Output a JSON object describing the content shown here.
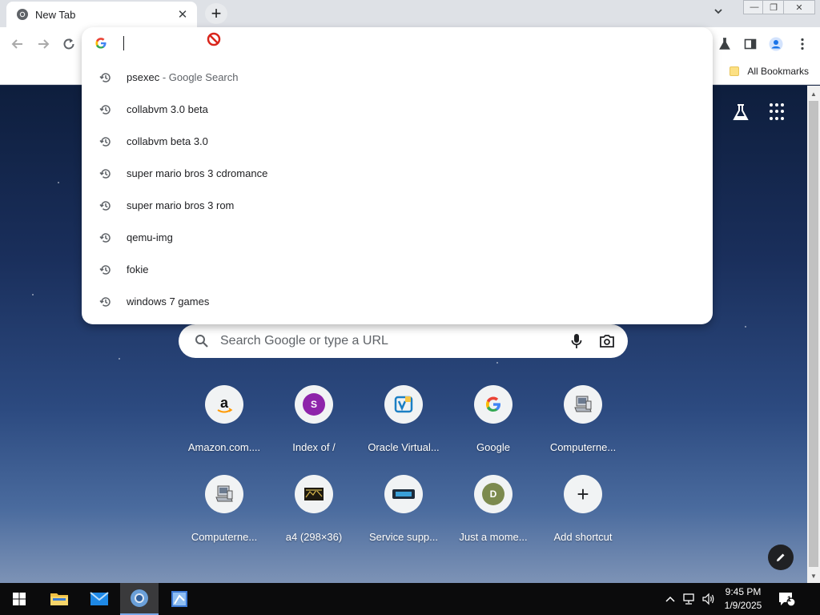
{
  "tab": {
    "title": "New Tab",
    "close_glyph": "✕"
  },
  "newtab_glyph": "+",
  "window_controls": {
    "minimize": "—",
    "maximize": "❐",
    "close": "✕"
  },
  "bookmarks": {
    "all_label": "All Bookmarks"
  },
  "omnibox": {
    "value": "",
    "suggestions": [
      {
        "text": "psexec",
        "suffix": " - Google Search"
      },
      {
        "text": "collabvm 3.0 beta",
        "suffix": ""
      },
      {
        "text": "collabvm beta 3.0",
        "suffix": ""
      },
      {
        "text": "super mario bros 3 cdromance",
        "suffix": ""
      },
      {
        "text": "super mario bros 3 rom",
        "suffix": ""
      },
      {
        "text": "qemu-img",
        "suffix": ""
      },
      {
        "text": "fokie",
        "suffix": ""
      },
      {
        "text": "windows 7 games",
        "suffix": ""
      }
    ]
  },
  "ntp": {
    "search_placeholder": "Search Google or type a URL",
    "shortcuts": [
      {
        "label": "Amazon.com....",
        "icon": "amazon-icon"
      },
      {
        "label": "Index of /",
        "icon": "letter-s-icon",
        "letter": "S"
      },
      {
        "label": "Oracle Virtual...",
        "icon": "virtualbox-icon"
      },
      {
        "label": "Google",
        "icon": "google-icon"
      },
      {
        "label": "Computerne...",
        "icon": "computer-icon"
      },
      {
        "label": "Computerne...",
        "icon": "computer-icon"
      },
      {
        "label": "a4 (298×36)",
        "icon": "image-thumbnail-icon"
      },
      {
        "label": "Service supp...",
        "icon": "service-logo-icon"
      },
      {
        "label": "Just a mome...",
        "icon": "letter-d-icon",
        "letter": "D"
      },
      {
        "label": "Add shortcut",
        "icon": "plus-icon",
        "glyph": "+"
      }
    ]
  },
  "taskbar": {
    "time": "9:45 PM",
    "date": "1/9/2025",
    "notification_count": "1"
  },
  "colors": {
    "accent_blue": "#1a73e8",
    "shortcut_s_bg": "#8e24aa",
    "shortcut_d_bg": "#7c8a4e"
  }
}
